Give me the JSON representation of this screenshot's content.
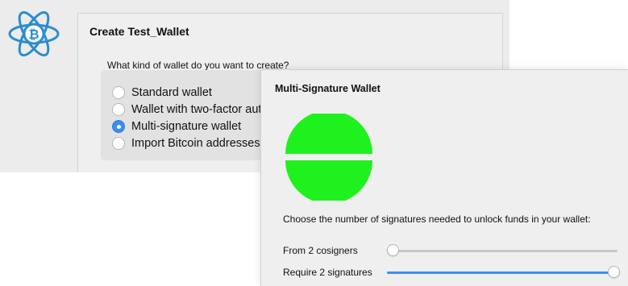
{
  "back_window": {
    "title": "Create Test_Wallet",
    "question": "What kind of wallet do you want to create?",
    "options": [
      {
        "label": "Standard wallet",
        "checked": false
      },
      {
        "label": "Wallet with two-factor authentication",
        "checked": false
      },
      {
        "label": "Multi-signature wallet",
        "checked": true
      },
      {
        "label": "Import Bitcoin addresses or private keys",
        "checked": false
      }
    ],
    "logo_icon": "bitcoin-atom-logo-icon"
  },
  "front_window": {
    "title": "Multi-Signature Wallet",
    "description": "Choose the number of signatures needed to unlock funds in your wallet:",
    "cosigners_label": "From 2 cosigners",
    "cosigners_value": 2,
    "signatures_label": "Require 2 signatures",
    "signatures_value": 2,
    "signatures_fraction": 1.0,
    "cosigners_fraction": 0.0
  },
  "colors": {
    "accent": "#3d8ef2",
    "signature_fill": "#1ff11f",
    "logo_blue": "#2d8ccf"
  }
}
